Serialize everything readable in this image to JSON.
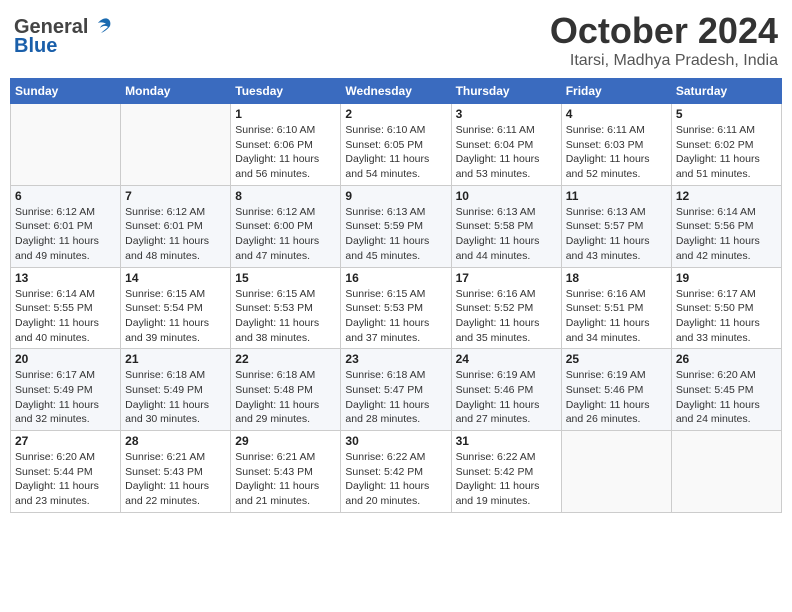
{
  "header": {
    "logo_general": "General",
    "logo_blue": "Blue",
    "month": "October 2024",
    "location": "Itarsi, Madhya Pradesh, India"
  },
  "weekdays": [
    "Sunday",
    "Monday",
    "Tuesday",
    "Wednesday",
    "Thursday",
    "Friday",
    "Saturday"
  ],
  "weeks": [
    [
      {
        "day": "",
        "sunrise": "",
        "sunset": "",
        "daylight": ""
      },
      {
        "day": "",
        "sunrise": "",
        "sunset": "",
        "daylight": ""
      },
      {
        "day": "1",
        "sunrise": "Sunrise: 6:10 AM",
        "sunset": "Sunset: 6:06 PM",
        "daylight": "Daylight: 11 hours and 56 minutes."
      },
      {
        "day": "2",
        "sunrise": "Sunrise: 6:10 AM",
        "sunset": "Sunset: 6:05 PM",
        "daylight": "Daylight: 11 hours and 54 minutes."
      },
      {
        "day": "3",
        "sunrise": "Sunrise: 6:11 AM",
        "sunset": "Sunset: 6:04 PM",
        "daylight": "Daylight: 11 hours and 53 minutes."
      },
      {
        "day": "4",
        "sunrise": "Sunrise: 6:11 AM",
        "sunset": "Sunset: 6:03 PM",
        "daylight": "Daylight: 11 hours and 52 minutes."
      },
      {
        "day": "5",
        "sunrise": "Sunrise: 6:11 AM",
        "sunset": "Sunset: 6:02 PM",
        "daylight": "Daylight: 11 hours and 51 minutes."
      }
    ],
    [
      {
        "day": "6",
        "sunrise": "Sunrise: 6:12 AM",
        "sunset": "Sunset: 6:01 PM",
        "daylight": "Daylight: 11 hours and 49 minutes."
      },
      {
        "day": "7",
        "sunrise": "Sunrise: 6:12 AM",
        "sunset": "Sunset: 6:01 PM",
        "daylight": "Daylight: 11 hours and 48 minutes."
      },
      {
        "day": "8",
        "sunrise": "Sunrise: 6:12 AM",
        "sunset": "Sunset: 6:00 PM",
        "daylight": "Daylight: 11 hours and 47 minutes."
      },
      {
        "day": "9",
        "sunrise": "Sunrise: 6:13 AM",
        "sunset": "Sunset: 5:59 PM",
        "daylight": "Daylight: 11 hours and 45 minutes."
      },
      {
        "day": "10",
        "sunrise": "Sunrise: 6:13 AM",
        "sunset": "Sunset: 5:58 PM",
        "daylight": "Daylight: 11 hours and 44 minutes."
      },
      {
        "day": "11",
        "sunrise": "Sunrise: 6:13 AM",
        "sunset": "Sunset: 5:57 PM",
        "daylight": "Daylight: 11 hours and 43 minutes."
      },
      {
        "day": "12",
        "sunrise": "Sunrise: 6:14 AM",
        "sunset": "Sunset: 5:56 PM",
        "daylight": "Daylight: 11 hours and 42 minutes."
      }
    ],
    [
      {
        "day": "13",
        "sunrise": "Sunrise: 6:14 AM",
        "sunset": "Sunset: 5:55 PM",
        "daylight": "Daylight: 11 hours and 40 minutes."
      },
      {
        "day": "14",
        "sunrise": "Sunrise: 6:15 AM",
        "sunset": "Sunset: 5:54 PM",
        "daylight": "Daylight: 11 hours and 39 minutes."
      },
      {
        "day": "15",
        "sunrise": "Sunrise: 6:15 AM",
        "sunset": "Sunset: 5:53 PM",
        "daylight": "Daylight: 11 hours and 38 minutes."
      },
      {
        "day": "16",
        "sunrise": "Sunrise: 6:15 AM",
        "sunset": "Sunset: 5:53 PM",
        "daylight": "Daylight: 11 hours and 37 minutes."
      },
      {
        "day": "17",
        "sunrise": "Sunrise: 6:16 AM",
        "sunset": "Sunset: 5:52 PM",
        "daylight": "Daylight: 11 hours and 35 minutes."
      },
      {
        "day": "18",
        "sunrise": "Sunrise: 6:16 AM",
        "sunset": "Sunset: 5:51 PM",
        "daylight": "Daylight: 11 hours and 34 minutes."
      },
      {
        "day": "19",
        "sunrise": "Sunrise: 6:17 AM",
        "sunset": "Sunset: 5:50 PM",
        "daylight": "Daylight: 11 hours and 33 minutes."
      }
    ],
    [
      {
        "day": "20",
        "sunrise": "Sunrise: 6:17 AM",
        "sunset": "Sunset: 5:49 PM",
        "daylight": "Daylight: 11 hours and 32 minutes."
      },
      {
        "day": "21",
        "sunrise": "Sunrise: 6:18 AM",
        "sunset": "Sunset: 5:49 PM",
        "daylight": "Daylight: 11 hours and 30 minutes."
      },
      {
        "day": "22",
        "sunrise": "Sunrise: 6:18 AM",
        "sunset": "Sunset: 5:48 PM",
        "daylight": "Daylight: 11 hours and 29 minutes."
      },
      {
        "day": "23",
        "sunrise": "Sunrise: 6:18 AM",
        "sunset": "Sunset: 5:47 PM",
        "daylight": "Daylight: 11 hours and 28 minutes."
      },
      {
        "day": "24",
        "sunrise": "Sunrise: 6:19 AM",
        "sunset": "Sunset: 5:46 PM",
        "daylight": "Daylight: 11 hours and 27 minutes."
      },
      {
        "day": "25",
        "sunrise": "Sunrise: 6:19 AM",
        "sunset": "Sunset: 5:46 PM",
        "daylight": "Daylight: 11 hours and 26 minutes."
      },
      {
        "day": "26",
        "sunrise": "Sunrise: 6:20 AM",
        "sunset": "Sunset: 5:45 PM",
        "daylight": "Daylight: 11 hours and 24 minutes."
      }
    ],
    [
      {
        "day": "27",
        "sunrise": "Sunrise: 6:20 AM",
        "sunset": "Sunset: 5:44 PM",
        "daylight": "Daylight: 11 hours and 23 minutes."
      },
      {
        "day": "28",
        "sunrise": "Sunrise: 6:21 AM",
        "sunset": "Sunset: 5:43 PM",
        "daylight": "Daylight: 11 hours and 22 minutes."
      },
      {
        "day": "29",
        "sunrise": "Sunrise: 6:21 AM",
        "sunset": "Sunset: 5:43 PM",
        "daylight": "Daylight: 11 hours and 21 minutes."
      },
      {
        "day": "30",
        "sunrise": "Sunrise: 6:22 AM",
        "sunset": "Sunset: 5:42 PM",
        "daylight": "Daylight: 11 hours and 20 minutes."
      },
      {
        "day": "31",
        "sunrise": "Sunrise: 6:22 AM",
        "sunset": "Sunset: 5:42 PM",
        "daylight": "Daylight: 11 hours and 19 minutes."
      },
      {
        "day": "",
        "sunrise": "",
        "sunset": "",
        "daylight": ""
      },
      {
        "day": "",
        "sunrise": "",
        "sunset": "",
        "daylight": ""
      }
    ]
  ]
}
